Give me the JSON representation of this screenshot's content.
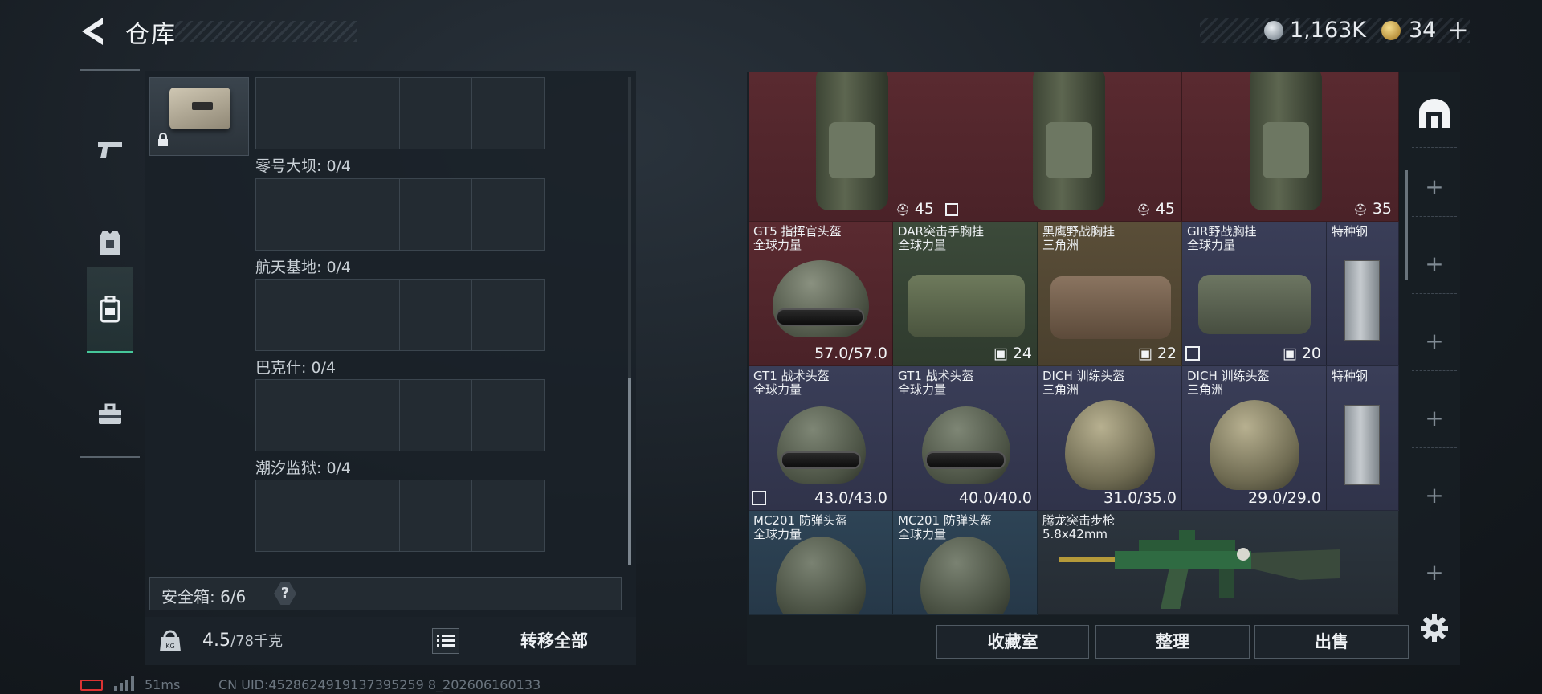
{
  "header": {
    "title": "仓库",
    "currency_silver": "1,163K",
    "currency_gold": "34",
    "plus": "+"
  },
  "left_panel": {
    "slots": [
      {
        "label": "零号大坝: 0/4"
      },
      {
        "label": "航天基地: 0/4"
      },
      {
        "label": "巴克什: 0/4"
      },
      {
        "label": "潮汐监狱: 0/4"
      }
    ],
    "safe_box": "安全箱: 6/6",
    "help": "?",
    "weight_main": "4.5",
    "weight_sub": "/78千克",
    "weight_icon_label": "KG",
    "transfer_all": "转移全部"
  },
  "status": {
    "ping": "51ms",
    "uid": "CN UID:4528624919137395259 8_202606160133"
  },
  "inventory": {
    "row0": [
      {
        "stat": "45"
      },
      {
        "stat": "45"
      },
      {
        "stat": "35"
      }
    ],
    "row1": [
      {
        "name": "GT5 指挥官头盔",
        "sub": "全球力量",
        "stat": "57.0/57.0"
      },
      {
        "name": "DAR突击手胸挂",
        "sub": "全球力量",
        "stat": "24"
      },
      {
        "name": "黑鹰野战胸挂",
        "sub": "三角洲",
        "stat": "22"
      },
      {
        "name": "GIR野战胸挂",
        "sub": "全球力量",
        "stat": "20"
      },
      {
        "name": "特种钢",
        "sub": "",
        "stat": ""
      }
    ],
    "row2": [
      {
        "name": "GT1 战术头盔",
        "sub": "全球力量",
        "stat": "43.0/43.0"
      },
      {
        "name": "GT1 战术头盔",
        "sub": "全球力量",
        "stat": "40.0/40.0"
      },
      {
        "name": "DICH 训练头盔",
        "sub": "三角洲",
        "stat": "31.0/35.0"
      },
      {
        "name": "DICH 训练头盔",
        "sub": "三角洲",
        "stat": "29.0/29.0"
      },
      {
        "name": "特种钢",
        "sub": "",
        "stat": ""
      }
    ],
    "row3": [
      {
        "name": "MC201 防弹头盔",
        "sub": "全球力量"
      },
      {
        "name": "MC201 防弹头盔",
        "sub": "全球力量"
      },
      {
        "name": "腾龙突击步枪",
        "sub": "5.8x42mm"
      }
    ]
  },
  "right_side": {
    "plus": "+"
  },
  "buttons": {
    "collection": "收藏室",
    "organize": "整理",
    "sell": "出售"
  },
  "colors": {
    "accent_green": "#46c79a",
    "rarity_red": "#5a2a30",
    "rarity_purple": "#3a3e58",
    "rarity_gold": "#5a4e38",
    "rarity_blue": "#2e4456"
  },
  "icons": {
    "back": "back-arrow-icon",
    "silver": "silver-coin-icon",
    "gold": "gold-coin-icon",
    "nav": [
      "pistol-icon",
      "vest-icon",
      "backpack-icon",
      "toolbox-icon"
    ],
    "lock": "lock-icon",
    "list": "list-icon",
    "settings": "gear-icon",
    "vault": "vault-icon"
  }
}
